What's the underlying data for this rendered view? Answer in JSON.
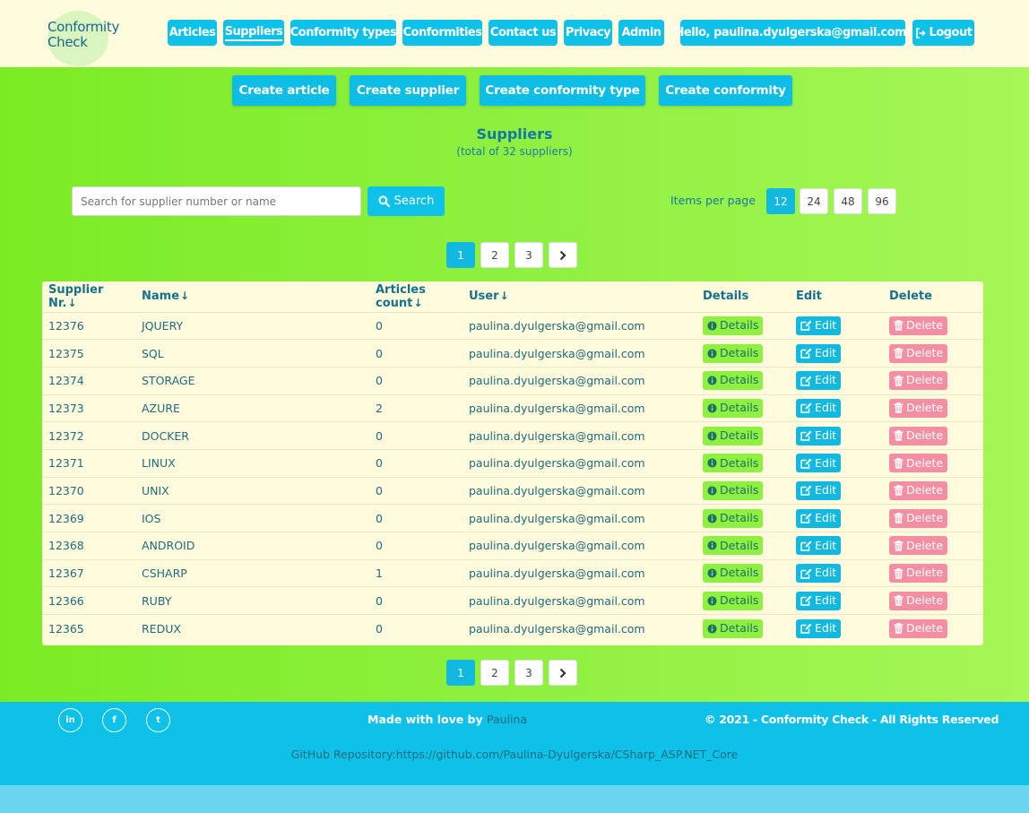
{
  "brand": {
    "line1": "Conformity",
    "line2": "Check"
  },
  "nav": {
    "items": [
      {
        "label": "Articles"
      },
      {
        "label": "Suppliers"
      },
      {
        "label": "Conformity types"
      },
      {
        "label": "Conformities"
      },
      {
        "label": "Contact us"
      },
      {
        "label": "Privacy"
      },
      {
        "label": "Admin"
      }
    ],
    "greeting": "Hello, paulina.dyulgerska@gmail.com!",
    "logout": "Logout"
  },
  "actions": [
    "Create article",
    "Create supplier",
    "Create conformity type",
    "Create conformity"
  ],
  "page": {
    "title": "Suppliers",
    "subtitle": "(total of 32 suppliers)"
  },
  "search": {
    "placeholder": "Search for supplier number or name",
    "value": "",
    "button": "Search"
  },
  "items_per_page": {
    "label": "Items per page",
    "options": [
      "12",
      "24",
      "48",
      "96"
    ],
    "selected": "12"
  },
  "pagination": {
    "pages": [
      "1",
      "2",
      "3"
    ],
    "current": "1"
  },
  "table": {
    "headers": {
      "supplier_nr": "Supplier Nr.",
      "name": "Name",
      "articles_count": "Articles count",
      "user": "User",
      "details": "Details",
      "edit": "Edit",
      "delete": "Delete"
    },
    "row_actions": {
      "details": "Details",
      "edit": "Edit",
      "delete": "Delete"
    },
    "rows": [
      {
        "nr": "12376",
        "name": "JQUERY",
        "count": "0",
        "user": "paulina.dyulgerska@gmail.com"
      },
      {
        "nr": "12375",
        "name": "SQL",
        "count": "0",
        "user": "paulina.dyulgerska@gmail.com"
      },
      {
        "nr": "12374",
        "name": "STORAGE",
        "count": "0",
        "user": "paulina.dyulgerska@gmail.com"
      },
      {
        "nr": "12373",
        "name": "AZURE",
        "count": "2",
        "user": "paulina.dyulgerska@gmail.com"
      },
      {
        "nr": "12372",
        "name": "DOCKER",
        "count": "0",
        "user": "paulina.dyulgerska@gmail.com"
      },
      {
        "nr": "12371",
        "name": "LINUX",
        "count": "0",
        "user": "paulina.dyulgerska@gmail.com"
      },
      {
        "nr": "12370",
        "name": "UNIX",
        "count": "0",
        "user": "paulina.dyulgerska@gmail.com"
      },
      {
        "nr": "12369",
        "name": "IOS",
        "count": "0",
        "user": "paulina.dyulgerska@gmail.com"
      },
      {
        "nr": "12368",
        "name": "ANDROID",
        "count": "0",
        "user": "paulina.dyulgerska@gmail.com"
      },
      {
        "nr": "12367",
        "name": "CSHARP",
        "count": "1",
        "user": "paulina.dyulgerska@gmail.com"
      },
      {
        "nr": "12366",
        "name": "RUBY",
        "count": "0",
        "user": "paulina.dyulgerska@gmail.com"
      },
      {
        "nr": "12365",
        "name": "REDUX",
        "count": "0",
        "user": "paulina.dyulgerska@gmail.com"
      }
    ]
  },
  "footer": {
    "social": [
      {
        "icon": "linkedin-icon",
        "glyph": "in"
      },
      {
        "icon": "facebook-icon",
        "glyph": "f"
      },
      {
        "icon": "twitter-icon",
        "glyph": "t"
      }
    ],
    "made_with": "Made with love by",
    "author": "Paulina",
    "copyright": "© 2021 - Conformity Check - All Rights Reserved",
    "github": "GitHub Repository:https://github.com/Paulina-Dyulgerska/CSharp_ASP.NET_Core"
  },
  "colors": {
    "accent": "#0ec1e8",
    "header_bg": "#fffbdc",
    "page_green": "#8ef03f",
    "delete_pink": "#f58ea3",
    "title_blue": "#1577a6"
  }
}
